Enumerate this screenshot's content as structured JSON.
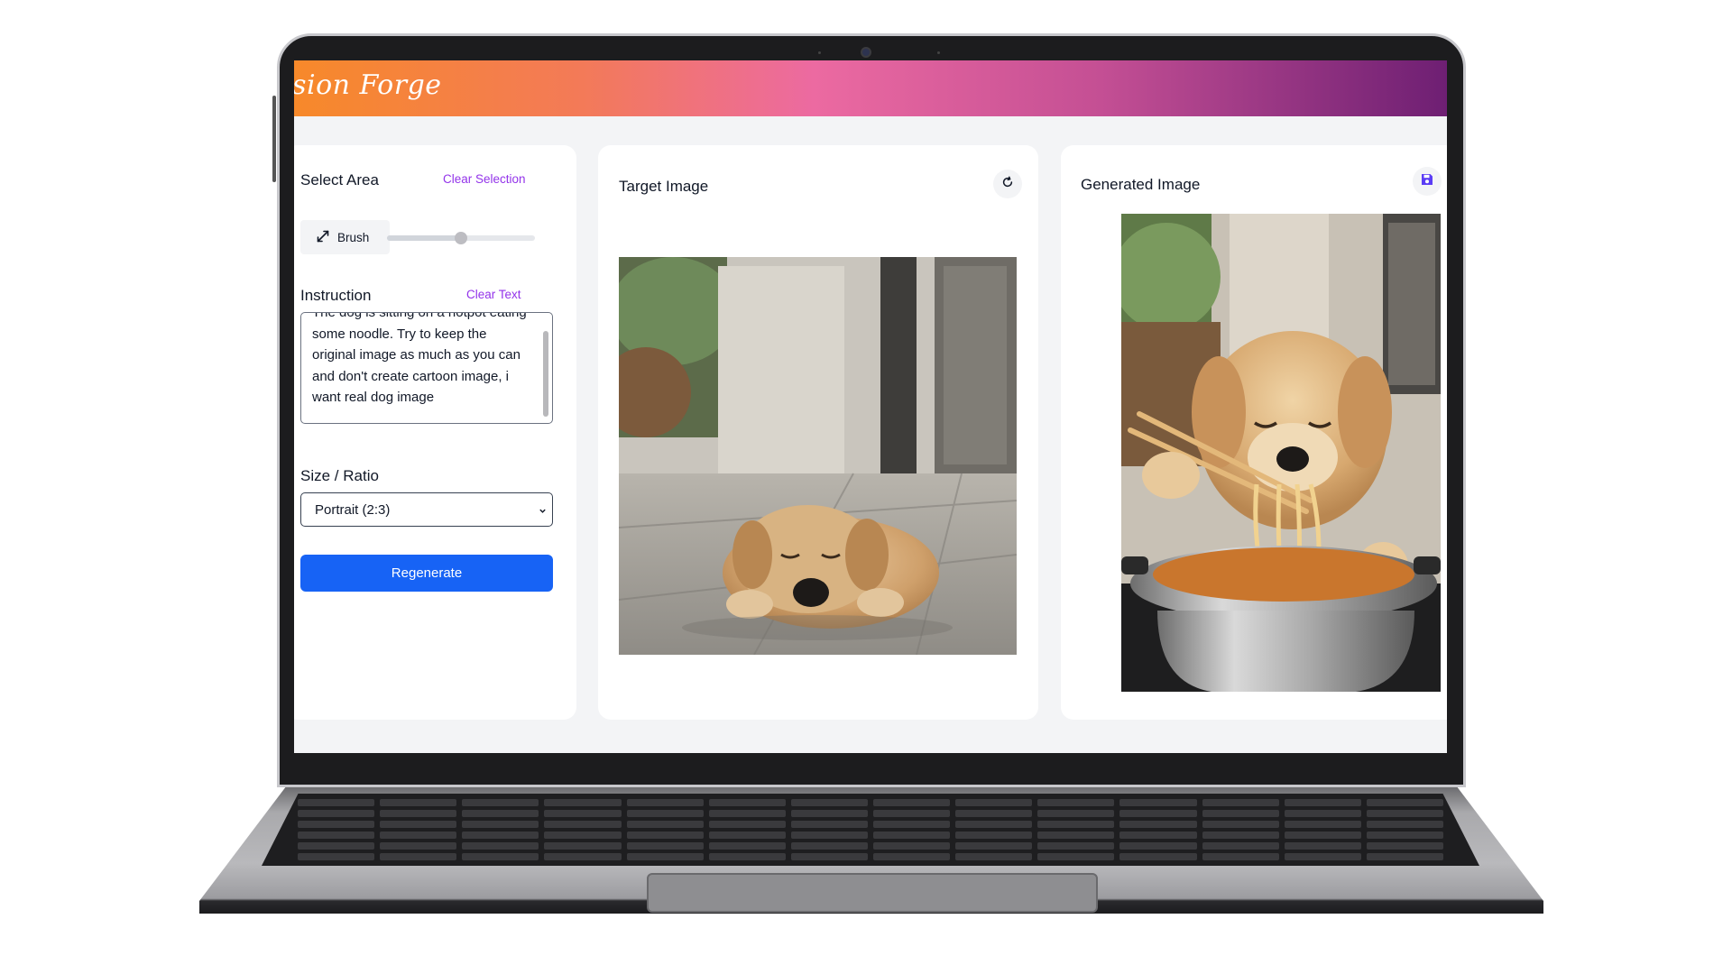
{
  "app": {
    "brand": "ision Forge"
  },
  "left_panel": {
    "select_area_title": "Select Area",
    "clear_selection_label": "Clear Selection",
    "brush_label": "Brush",
    "brush_size_fraction": 0.5,
    "instruction_title": "Instruction",
    "clear_text_label": "Clear Text",
    "instruction_value": "The dog is sitting on a hotpot eating some noodle. Try to keep the original image as much as you can and don't create cartoon image, i want real dog image",
    "size_ratio_title": "Size / Ratio",
    "size_ratio_selected": "Portrait (2:3)",
    "regenerate_label": "Regenerate"
  },
  "target_panel": {
    "title": "Target Image",
    "refresh_icon": "refresh-icon"
  },
  "generated_panel": {
    "title": "Generated Image",
    "save_icon": "save-icon"
  },
  "colors": {
    "accent_purple": "#9333ea",
    "primary_blue": "#1763f5",
    "save_icon": "#5b3df5"
  }
}
